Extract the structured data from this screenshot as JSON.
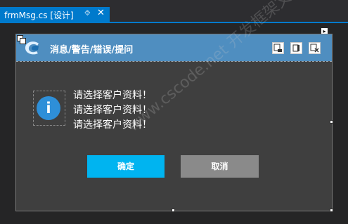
{
  "tab": {
    "title": "frmMsg.cs [设计]",
    "pin_icon": "pin-icon",
    "close_icon": "close-icon"
  },
  "form": {
    "title": "消息/警告/错误/提问",
    "logo_icon": "app-logo-icon",
    "window_buttons": [
      "minimize-button-icon",
      "maximize-button-icon",
      "close-button-icon"
    ]
  },
  "message": {
    "icon": "info-icon",
    "lines": [
      "请选择客户资料！",
      "请选择客户资料！",
      "请选择客户资料！"
    ]
  },
  "buttons": {
    "ok_label": "确定",
    "cancel_label": "取消"
  },
  "watermark": "www.cscode.net 开发框架文库",
  "colors": {
    "tab_accent": "#007acc",
    "titlebar": "#4f8ec0",
    "form_background": "#3f3f3f",
    "ok_button": "#00b4f0",
    "cancel_button": "#8a8a8a",
    "info_icon": "#2e8fd8"
  }
}
